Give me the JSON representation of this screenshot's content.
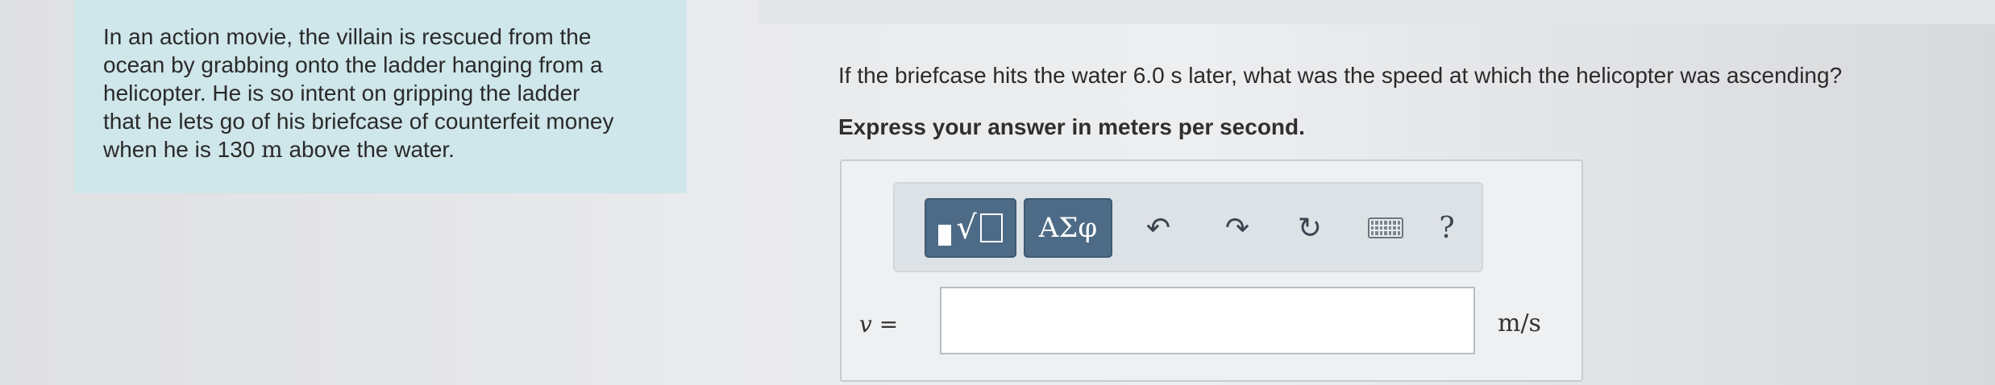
{
  "problem": {
    "lines": [
      "In an action movie, the villain is rescued from the",
      "ocean by grabbing onto the ladder hanging from a",
      "helicopter. He is so intent on gripping the ladder",
      "that he lets go of his briefcase of counterfeit money"
    ],
    "last_line_prefix": "when he is 130 ",
    "last_line_unit": "m",
    "last_line_suffix": " above the water."
  },
  "question": {
    "text": "If the briefcase hits the water 6.0  s later, what was the speed at which the helicopter was ascending?",
    "instruction": "Express your answer in meters per second."
  },
  "toolbar": {
    "template_label": "√",
    "greek_label": "ΑΣφ",
    "undo_glyph": "↶",
    "redo_glyph": "↷",
    "reset_glyph": "↻",
    "help_label": "?"
  },
  "answer": {
    "variable": "v",
    "equals": " =",
    "value": "",
    "unit": "m/s"
  }
}
